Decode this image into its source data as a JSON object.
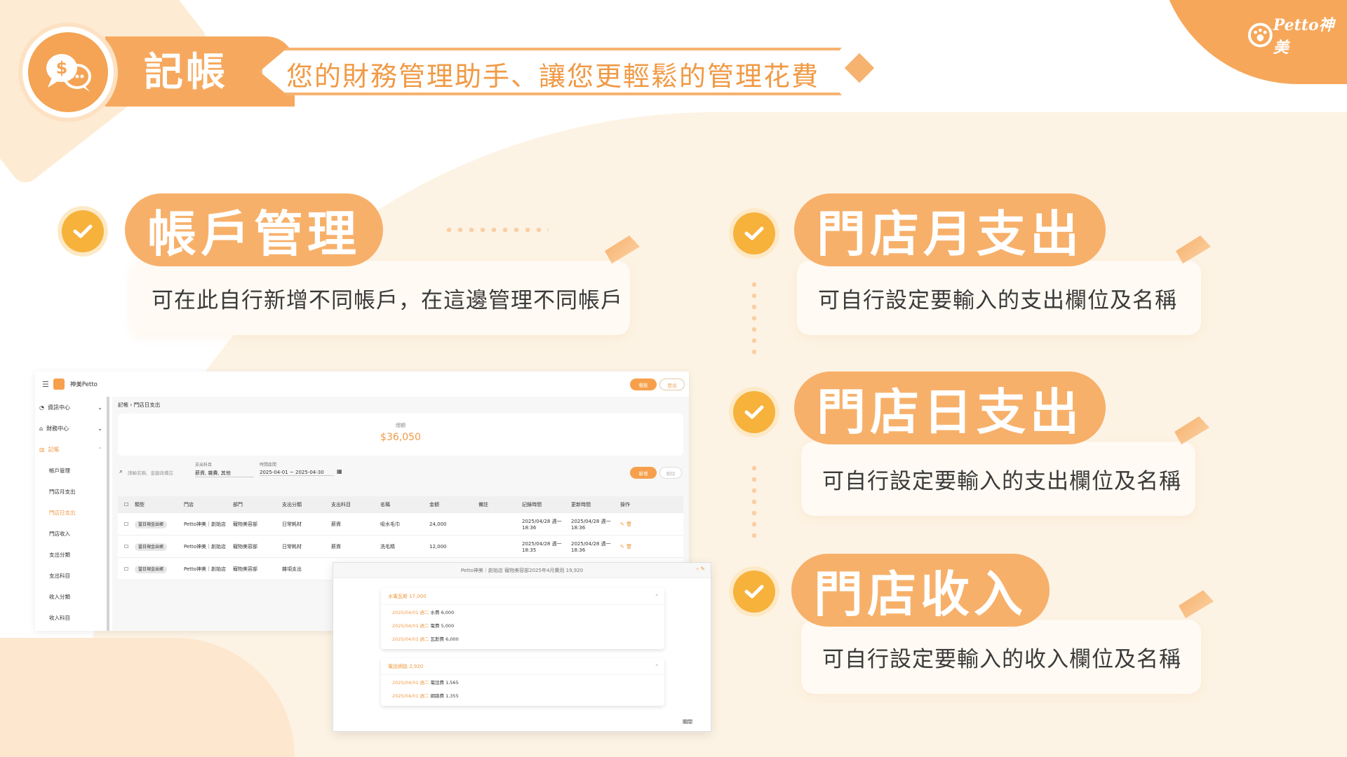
{
  "header": {
    "title": "記帳",
    "subtitle": "您的財務管理助手、讓您更輕鬆的管理花費",
    "brand_logo": "Petto神美"
  },
  "features": [
    {
      "title": "帳戶管理",
      "description": "可在此自行新增不同帳戶，在這邊管理不同帳戶"
    },
    {
      "title": "門店月支出",
      "description": "可自行設定要輸入的支出欄位及名稱"
    },
    {
      "title": "門店日支出",
      "description": "可自行設定要輸入的支出欄位及名稱"
    },
    {
      "title": "門店收入",
      "description": "可自行設定要輸入的收入欄位及名稱"
    }
  ],
  "app": {
    "brand": "神美Petto",
    "top_buttons": {
      "primary": "餐飲",
      "secondary": "登出"
    },
    "sidebar": {
      "groups": [
        {
          "label": "資訊中心"
        },
        {
          "label": "財務中心"
        },
        {
          "label": "記帳"
        }
      ],
      "items": [
        "帳戶管理",
        "門店月支出",
        "門店日支出",
        "門店收入",
        "支出分類",
        "支出科目",
        "收入分類",
        "收入科目"
      ]
    },
    "breadcrumb": {
      "parent": "記帳",
      "current": "門店日支出"
    },
    "summary": {
      "label": "總額",
      "value": "$36,050"
    },
    "filters": {
      "search_placeholder": "請輸名稱、金額與備註",
      "subject_label": "支出科目",
      "subject_value": "薪資, 雜費, 其他",
      "date_label": "時間區間",
      "date_value": "2025-04-01 ~ 2025-04-30",
      "add_label": "新增",
      "delete_label": "刪除"
    },
    "table": {
      "columns": [
        "類型",
        "門店",
        "部門",
        "支出分類",
        "支出科目",
        "名稱",
        "金額",
        "備註",
        "記錄時間",
        "更新時間",
        "操作"
      ],
      "rows": [
        {
          "type": "當日現金出帳",
          "store": "Petto神美｜創始店",
          "dept": "寵物美容部",
          "category": "日常耗材",
          "subject": "薪資",
          "name": "吸水毛巾",
          "amount": "24,000",
          "note": "",
          "created": "2025/04/28 週一 18:36",
          "updated": "2025/04/28 週一 18:36"
        },
        {
          "type": "當日現金出帳",
          "store": "Petto神美｜創始店",
          "dept": "寵物美容部",
          "category": "日常耗材",
          "subject": "薪資",
          "name": "洗毛精",
          "amount": "12,000",
          "note": "",
          "created": "2025/04/28 週一 18:35",
          "updated": "2025/04/28 週一 18:36"
        },
        {
          "type": "當日現金出帳",
          "store": "Petto神美｜創始店",
          "dept": "寵物美容部",
          "category": "雜項支出",
          "subject": "",
          "name": "",
          "amount": "",
          "note": "",
          "created": "",
          "updated": ""
        }
      ]
    },
    "popup": {
      "title": "Petto神美｜創始店 寵物美容部2025年4月費用 19,920",
      "groups": [
        {
          "title": "水電瓦斯 17,000",
          "lines": [
            {
              "date": "2025/04/01 週二",
              "text": "水費 6,000"
            },
            {
              "date": "2025/04/01 週二",
              "text": "電費 5,000"
            },
            {
              "date": "2025/04/01 週二",
              "text": "瓦斯費 6,000"
            }
          ]
        },
        {
          "title": "電話網路 2,920",
          "lines": [
            {
              "date": "2025/04/01 週二",
              "text": "電話費 1,565"
            },
            {
              "date": "2025/04/01 週二",
              "text": "網路費 1,355"
            }
          ]
        }
      ],
      "close_label": "關閉"
    }
  },
  "colors": {
    "accent": "#f6a95e",
    "check": "#f7b23c",
    "text": "#3a3a3a"
  }
}
